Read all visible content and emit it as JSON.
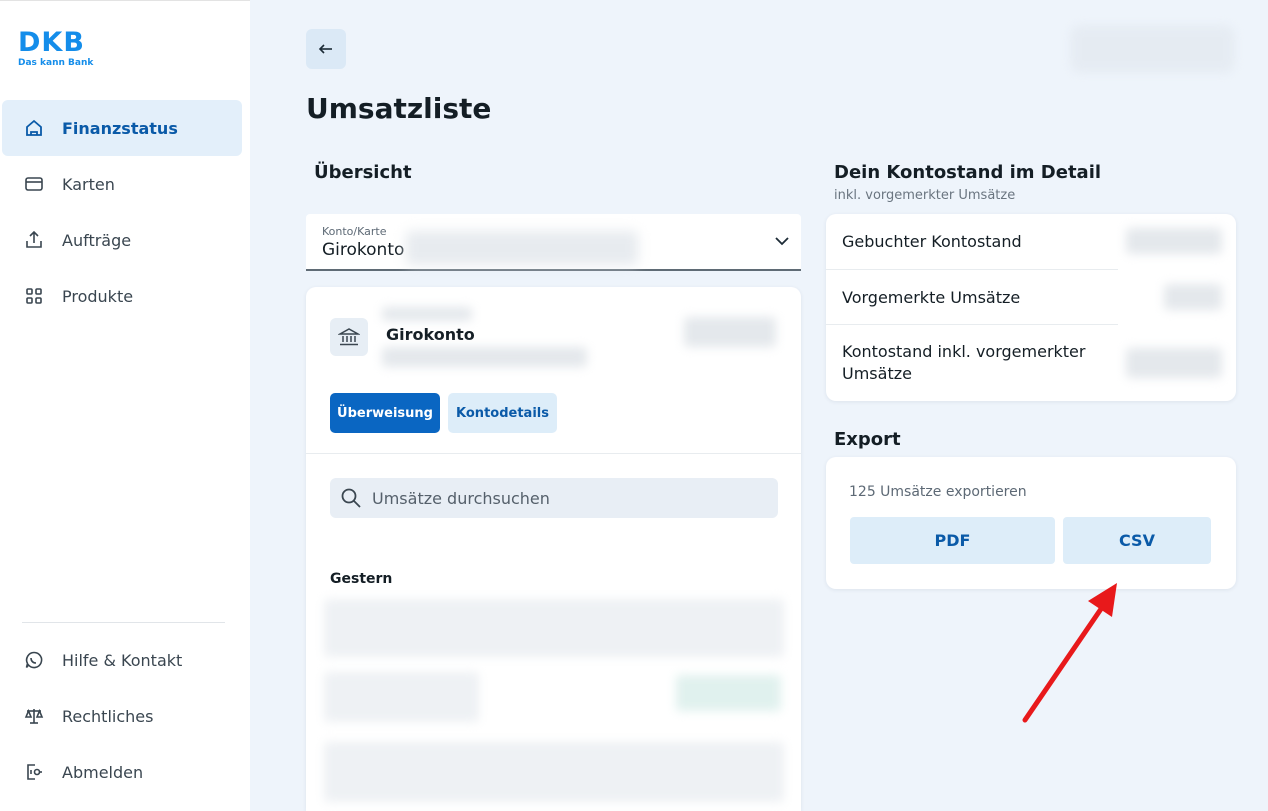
{
  "brand": {
    "name": "DKB",
    "tagline": "Das kann Bank"
  },
  "sidebar": {
    "items": [
      {
        "label": "Finanzstatus",
        "icon": "home-icon",
        "active": true
      },
      {
        "label": "Karten",
        "icon": "card-icon"
      },
      {
        "label": "Aufträge",
        "icon": "upload-icon"
      },
      {
        "label": "Produkte",
        "icon": "grid-icon"
      }
    ],
    "footer": [
      {
        "label": "Hilfe & Kontakt",
        "icon": "chat-icon"
      },
      {
        "label": "Rechtliches",
        "icon": "scale-icon"
      },
      {
        "label": "Abmelden",
        "icon": "logout-icon"
      }
    ]
  },
  "page": {
    "title": "Umsatzliste"
  },
  "overview": {
    "heading": "Übersicht",
    "select_label": "Konto/Karte",
    "select_value": "Girokonto",
    "account_name": "Girokonto",
    "transfer_button": "Überweisung",
    "details_button": "Kontodetails",
    "search_placeholder": "Umsätze durchsuchen",
    "group_label": "Gestern"
  },
  "balance": {
    "heading": "Dein Kontostand im Detail",
    "subheading": "inkl. vorgemerkter Umsätze",
    "rows": [
      {
        "label": "Gebuchter Kontostand"
      },
      {
        "label": "Vorgemerkte Umsätze"
      },
      {
        "label": "Kontostand inkl. vorgemerkter Umsätze"
      }
    ]
  },
  "export": {
    "heading": "Export",
    "count_text": "125 Umsätze exportieren",
    "pdf_label": "PDF",
    "csv_label": "CSV"
  },
  "colors": {
    "accent": "#0a66c2",
    "brand": "#148dea",
    "arrow": "#e8191b"
  }
}
